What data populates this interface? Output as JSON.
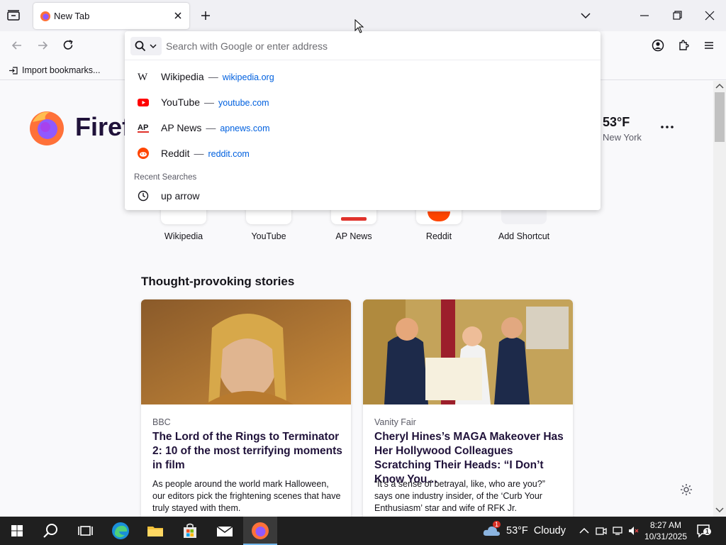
{
  "browser": {
    "tab_title": "New Tab"
  },
  "bookmarks": {
    "import_label": "Import bookmarks..."
  },
  "urlbar": {
    "placeholder": "Search with Google or enter address",
    "suggestions": [
      {
        "name": "Wikipedia",
        "url": "wikipedia.org",
        "icon": "wikipedia-icon"
      },
      {
        "name": "YouTube",
        "url": "youtube.com",
        "icon": "youtube-icon"
      },
      {
        "name": "AP News",
        "url": "apnews.com",
        "icon": "ap-news-icon"
      },
      {
        "name": "Reddit",
        "url": "reddit.com",
        "icon": "reddit-icon"
      }
    ],
    "separator": "—",
    "recent_heading": "Recent Searches",
    "recent": [
      {
        "text": "up arrow",
        "icon": "history-clock-icon"
      }
    ]
  },
  "newtab": {
    "brand_word": "Firef",
    "weather": {
      "temp": "53°F",
      "city": "New York"
    },
    "shortcuts": [
      "Wikipedia",
      "YouTube",
      "AP News",
      "Reddit",
      "Add Shortcut"
    ],
    "stories_heading": "Thought-provoking stories",
    "stories": [
      {
        "source": "BBC",
        "title": "The Lord of the Rings to Terminator 2: 10 of the most terrifying moments in film",
        "excerpt": "As people around the world mark Halloween, our editors pick the frightening scenes that have truly stayed with them."
      },
      {
        "source": "Vanity Fair",
        "title": "Cheryl Hines’s MAGA Makeover Has Her Hollywood Colleagues Scratching Their Heads: “I Don’t Know You…",
        "excerpt": "“It’s a sense of betrayal, like, who are you?” says one industry insider, of the ‘Curb Your Enthusiasm’ star and wife of RFK Jr."
      }
    ]
  },
  "taskbar": {
    "weather": "53°F  Cloudy",
    "weather_badge": "1",
    "time": "8:27 AM",
    "date": "10/31/2025",
    "notification_count": "1"
  },
  "colors": {
    "accent": "#0060df",
    "firefox_orange": "#ff7139",
    "firefox_purple": "#9059ff",
    "taskbar": "#1f1f1f"
  }
}
